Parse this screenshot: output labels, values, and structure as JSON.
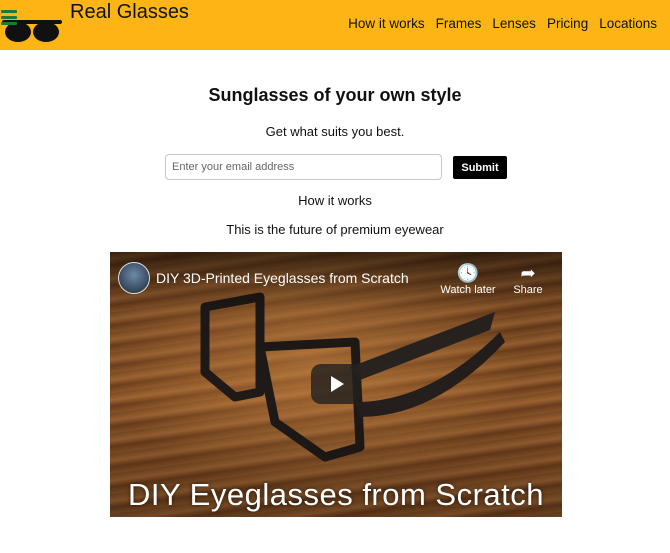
{
  "header": {
    "brand": "Real Glasses",
    "nav": [
      "How it works",
      "Frames",
      "Lenses",
      "Pricing",
      "Locations"
    ]
  },
  "hero": {
    "title": "Sunglasses of your own style",
    "subtitle": "Get what suits you best.",
    "email_placeholder": "Enter your email address",
    "submit_label": "Submit"
  },
  "section": {
    "heading": "How it works",
    "text": "This is the future of premium eyewear"
  },
  "video": {
    "title": "DIY 3D-Printed Eyeglasses from Scratch",
    "watch_later": "Watch later",
    "share": "Share",
    "caption": "DIY Eyeglasses from Scratch"
  },
  "icons": {
    "logo": "sunglasses-logo",
    "menu": "hamburger-icon",
    "watch_later": "clock-icon",
    "share": "share-arrow-icon",
    "play": "play-icon"
  },
  "colors": {
    "header_bg": "#fdb516",
    "submit_bg": "#000000"
  }
}
